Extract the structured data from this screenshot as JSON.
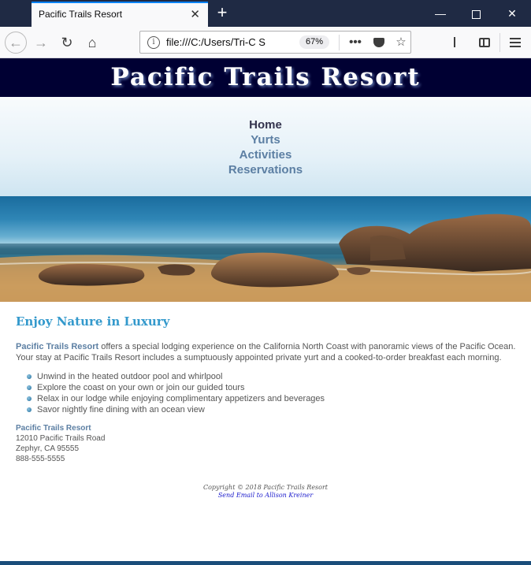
{
  "browser": {
    "tab_title": "Pacific Trails Resort",
    "tab_close": "✕",
    "new_tab": "+",
    "window_controls": {
      "minimize": "—",
      "close": "✕"
    },
    "nav": {
      "back": "←",
      "forward": "→",
      "reload": "↻",
      "home": "⌂"
    },
    "url": "file:///C:/Users/Tri-C S",
    "zoom": "67%",
    "info_icon": "i",
    "more_actions": "•••",
    "bookmark_star": "☆"
  },
  "site": {
    "title": "Pacific Trails Resort",
    "nav": {
      "items": [
        {
          "label": "Home"
        },
        {
          "label": "Yurts"
        },
        {
          "label": "Activities"
        },
        {
          "label": "Reservations"
        }
      ]
    },
    "main": {
      "heading": "Enjoy Nature in Luxury",
      "intro_name": "Pacific Trails Resort",
      "intro_text": " offers a special lodging experience on the California North Coast with panoramic views of the Pacific Ocean. Your stay at Pacific Trails Resort includes a sumptuously appointed private yurt and a cooked-to-order breakfast each morning.",
      "amenities": [
        "Unwind in the heated outdoor pool and whirlpool",
        "Explore the coast on your own or join our guided tours",
        "Relax in our lodge while enjoying complimentary appetizers and beverages",
        "Savor nightly fine dining with an ocean view"
      ],
      "contact": {
        "name": "Pacific Trails Resort",
        "street": "12010 Pacific Trails Road",
        "city": "Zephyr, CA 95555",
        "phone": "888-555-5555"
      }
    },
    "footer": {
      "copyright": "Copyright © 2018 Pacific Trails Resort",
      "email_link": "Send Email to Allison Kreiner"
    }
  }
}
